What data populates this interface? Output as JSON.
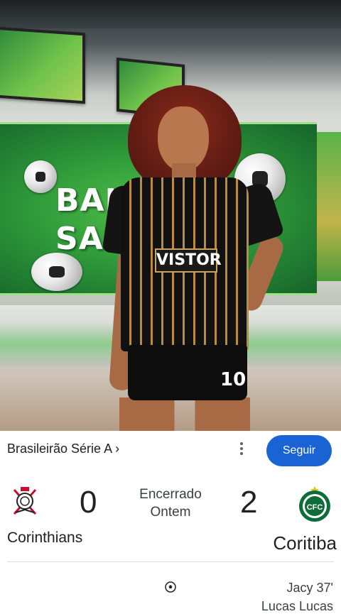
{
  "hero": {
    "wall_screen_text_line1": "BAIX",
    "wall_screen_text_line2": "SAN",
    "jersey_sponsor": "VISTOR",
    "shorts_number": "10"
  },
  "match": {
    "league_label": "Brasileirão Série A ›",
    "more_options_icon": "more-vert-icon",
    "follow_label": "Seguir",
    "home_team": {
      "name": "Corinthians",
      "score": "0",
      "crest_icon": "corinthians-crest-icon"
    },
    "away_team": {
      "name": "Coritiba",
      "score": "2",
      "crest_icon": "coritiba-crest-icon"
    },
    "status_line1": "Encerrado",
    "status_line2": "Ontem",
    "events": [
      {
        "icon": "soccer-ball-icon",
        "scorer": "Jacy 37'"
      },
      {
        "scorer": "Lucas Lucas"
      }
    ]
  },
  "colors": {
    "follow_button": "#1a63d4",
    "coritiba_green": "#0e6b3a",
    "corinthians_red": "#c8102e"
  }
}
